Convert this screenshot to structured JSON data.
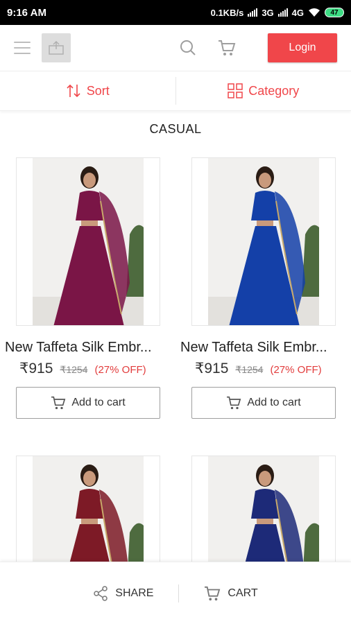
{
  "status_bar": {
    "time": "9:16 AM",
    "network_speed": "0.1KB/s",
    "network_3g": "3G",
    "network_4g": "4G",
    "battery": "47"
  },
  "app_bar": {
    "login_label": "Login"
  },
  "sort_bar": {
    "sort_label": "Sort",
    "category_label": "Category"
  },
  "section_title": "CASUAL",
  "products": [
    {
      "name": "New Taffeta Silk Embr...",
      "price": "₹915",
      "mrp": "₹1254",
      "discount": "(27% OFF)",
      "add_to_cart": "Add to cart",
      "color": "#7a1546"
    },
    {
      "name": "New Taffeta Silk Embr...",
      "price": "₹915",
      "mrp": "₹1254",
      "discount": "(27% OFF)",
      "add_to_cart": "Add to cart",
      "color": "#1440a8"
    },
    {
      "color": "#7d1a26"
    },
    {
      "color": "#1d2a78"
    }
  ],
  "bottom_bar": {
    "share_label": "SHARE",
    "cart_label": "CART"
  },
  "colors": {
    "accent": "#f0464a",
    "discount": "#e23c3c"
  }
}
